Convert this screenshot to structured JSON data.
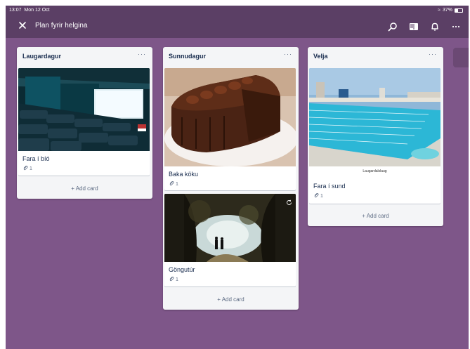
{
  "status_bar": {
    "time": "13:07",
    "date": "Mon 12 Oct",
    "battery": "37%"
  },
  "board": {
    "title": "Plan fyrir helgina"
  },
  "nav_icons": [
    "close-icon",
    "search-icon",
    "board-view-icon",
    "notifications-icon",
    "more-icon"
  ],
  "lists": [
    {
      "title": "Laugardagur",
      "menu": "···",
      "cards": [
        {
          "title": "Fara í bíó",
          "attachments": "1",
          "cover": "cinema"
        }
      ],
      "add_card": "+ Add card"
    },
    {
      "title": "Sunnudagur",
      "menu": "···",
      "cards": [
        {
          "title": "Baka köku",
          "attachments": "1",
          "cover": "chocolate-cake"
        },
        {
          "title": "Göngutúr",
          "attachments": "1",
          "cover": "walk-path"
        }
      ],
      "add_card": "+ Add card"
    },
    {
      "title": "Velja",
      "menu": "···",
      "cards": [
        {
          "title": "Fara í sund",
          "attachments": "1",
          "cover": "swimming-pool",
          "cover_caption": "Laugardalslaug"
        }
      ],
      "add_card": "+ Add card"
    }
  ],
  "colors": {
    "board_background": "#7e5689",
    "header": "#5b3f65",
    "list": "#f4f5f7"
  }
}
